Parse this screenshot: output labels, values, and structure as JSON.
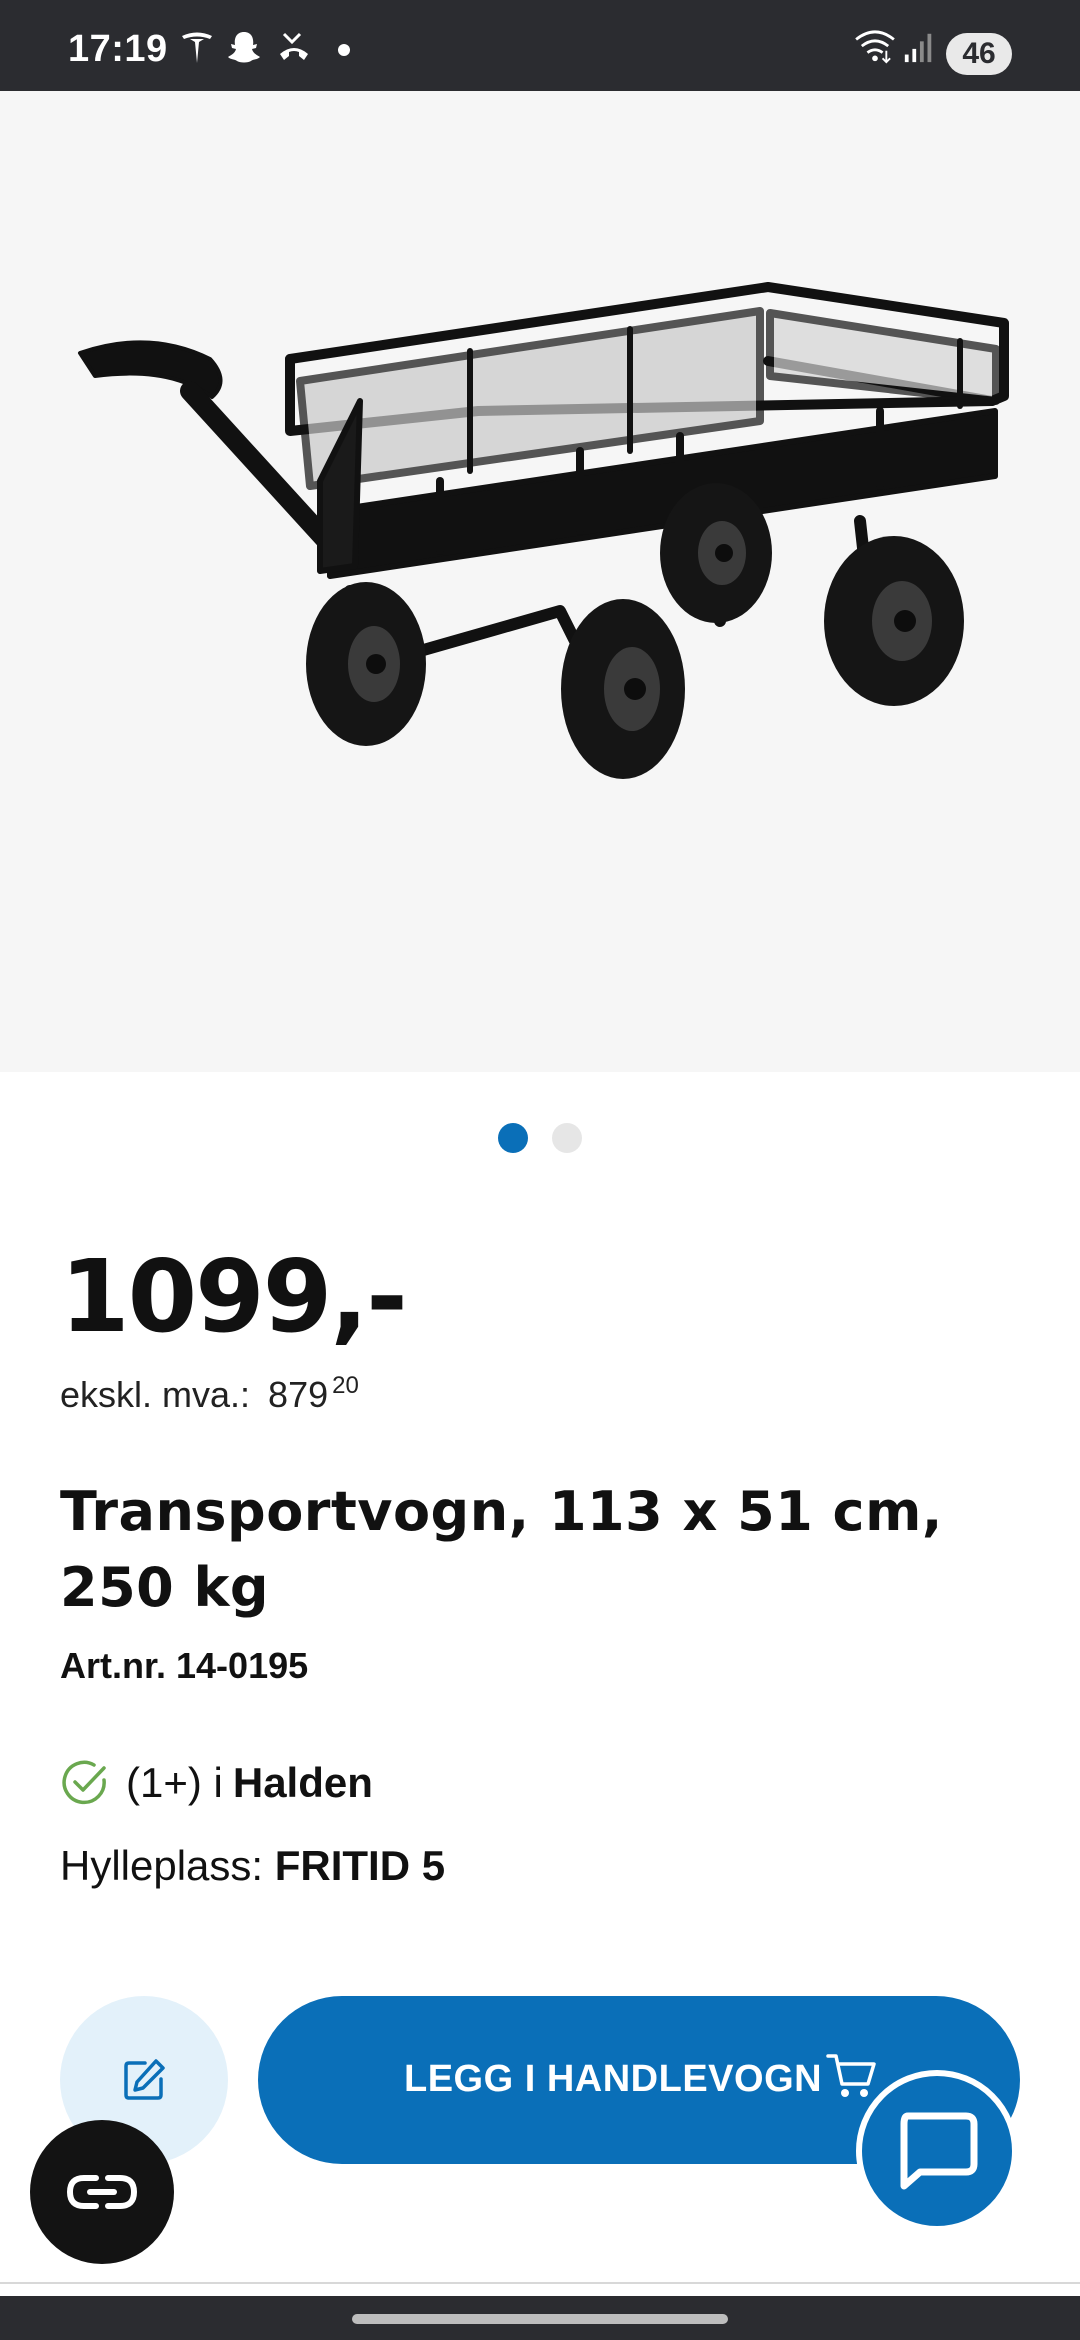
{
  "status_bar": {
    "time": "17:19",
    "battery": "46",
    "icons": [
      "tesla-icon",
      "snapchat-icon",
      "missed-call-icon",
      "wifi-icon",
      "signal-icon"
    ]
  },
  "gallery": {
    "image_alt": "cart-photo",
    "page_count": 2,
    "active_page": 1
  },
  "product": {
    "price": "1099,-",
    "ex_vat_label": "ekskl. mva.:",
    "ex_vat_value": "879",
    "ex_vat_decimals": "20",
    "title": "Transportvogn, 113 x 51 cm, 250 kg",
    "art_nr": "Art.nr. 14-0195",
    "stock_count": "(1+) i",
    "stock_store": "Halden",
    "shelf_label": "Hylleplass:",
    "shelf_value": "FRITID 5"
  },
  "actions": {
    "add_to_cart": "LEGG I HANDLEVOGN"
  },
  "colors": {
    "brand_blue": "#0a6fb8",
    "light_blue": "#e3f1fa",
    "stock_green": "#6aa84f"
  }
}
